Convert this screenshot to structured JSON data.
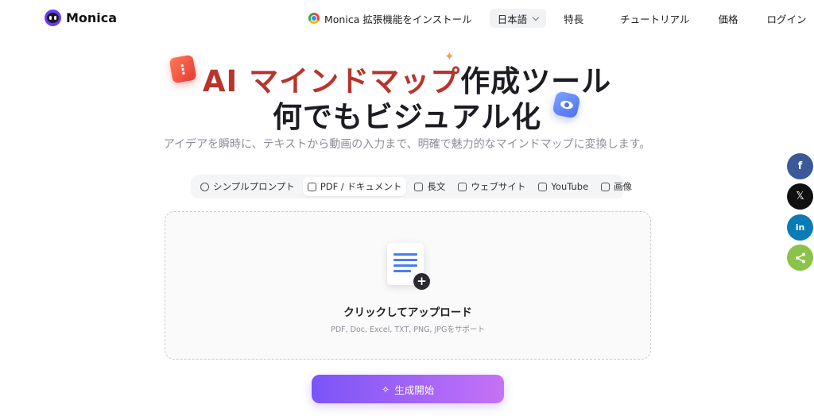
{
  "header": {
    "brand": "Monica",
    "install_label": "Monica 拡張機能をインストール",
    "language": "日本語",
    "nav": [
      "特長",
      "チュートリアル",
      "価格",
      "ログイン"
    ]
  },
  "hero": {
    "title_highlight": "AI マインドマップ",
    "title_rest": "作成ツール",
    "title_line2": "何でもビジュアル化",
    "subtitle": "アイデアを瞬時に、テキストから動画の入力まで、明確で魅力的なマインドマップに変換します。"
  },
  "tabs": [
    {
      "label": "シンプルプロンプト",
      "icon": "chat-icon",
      "active": false
    },
    {
      "label": "PDF / ドキュメント",
      "icon": "document-icon",
      "active": true
    },
    {
      "label": "長文",
      "icon": "text-icon",
      "active": false
    },
    {
      "label": "ウェブサイト",
      "icon": "monitor-icon",
      "active": false
    },
    {
      "label": "YouTube",
      "icon": "youtube-icon",
      "active": false
    },
    {
      "label": "画像",
      "icon": "image-icon",
      "active": false
    }
  ],
  "upload": {
    "title": "クリックしてアップロード",
    "hint": "PDF, Doc, Excel, TXT, PNG, JPGをサポート"
  },
  "generate_button": {
    "label": "生成開始",
    "icon": "sparkle-icon"
  },
  "share": {
    "facebook": "f",
    "x": "𝕏",
    "linkedin": "in",
    "share": "share-icon"
  },
  "colors": {
    "accent_start": "#7a55f7",
    "accent_end": "#c572f5",
    "title_highlight": "#b8342c"
  }
}
